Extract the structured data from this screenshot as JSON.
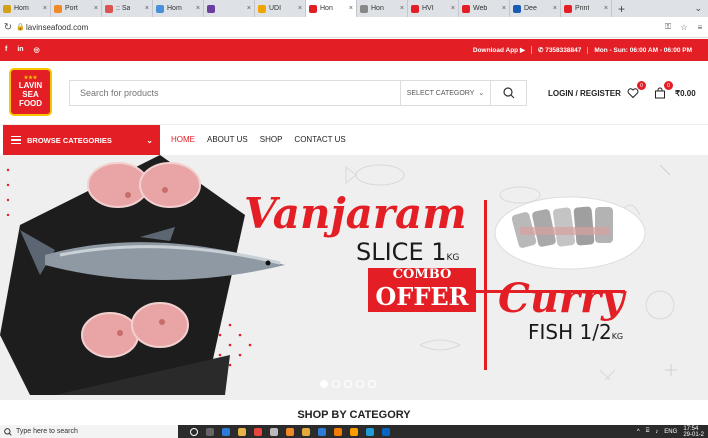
{
  "browser": {
    "tabs": [
      {
        "label": "Hom",
        "color": "#d4a017"
      },
      {
        "label": "Port",
        "color": "#f08a24"
      },
      {
        "label": ":: Sa",
        "color": "#d9534f"
      },
      {
        "label": "Hom",
        "color": "#4a90d9"
      },
      {
        "label": "",
        "color": "#6a3fa0"
      },
      {
        "label": "UDI",
        "color": "#f0a500"
      },
      {
        "label": "Hon",
        "color": "#e31e24"
      },
      {
        "label": "Hon",
        "color": "#888888"
      },
      {
        "label": "HVI",
        "color": "#e31e24"
      },
      {
        "label": "Web",
        "color": "#e31e24"
      },
      {
        "label": "Dee",
        "color": "#1a5bb5"
      },
      {
        "label": "Print",
        "color": "#e31e24"
      }
    ],
    "url": "lavinseafood.com"
  },
  "topbar": {
    "download": "Download App ▶ ",
    "phone": "✆ 7358338847",
    "hours": "Mon - Sun: 06:00 AM - 06:00 PM"
  },
  "header": {
    "logo_lines": [
      "LAVIN",
      "SEA",
      "FOOD"
    ],
    "search_placeholder": "Search for products",
    "category_select": "SELECT CATEGORY",
    "login": "LOGIN / REGISTER",
    "wishlist_count": "0",
    "cart_count": "0",
    "cart_total": "₹0.00"
  },
  "nav": {
    "browse": "BROWSE CATEGORIES",
    "links": [
      "HOME",
      "ABOUT US",
      "SHOP",
      "CONTACT US"
    ]
  },
  "banner": {
    "line1": "Vanjaram",
    "line2": "SLICE 1",
    "unit1": "KG",
    "combo1": "COMBO",
    "combo2": "OFFER",
    "line3": "Curry",
    "line4": "FISH 1/2",
    "unit2": "KG"
  },
  "section": {
    "title": "SHOP BY CATEGORY"
  },
  "taskbar": {
    "search": "Type here to search",
    "lang": "ENG",
    "time": "17:54",
    "date": "29-01-2"
  }
}
